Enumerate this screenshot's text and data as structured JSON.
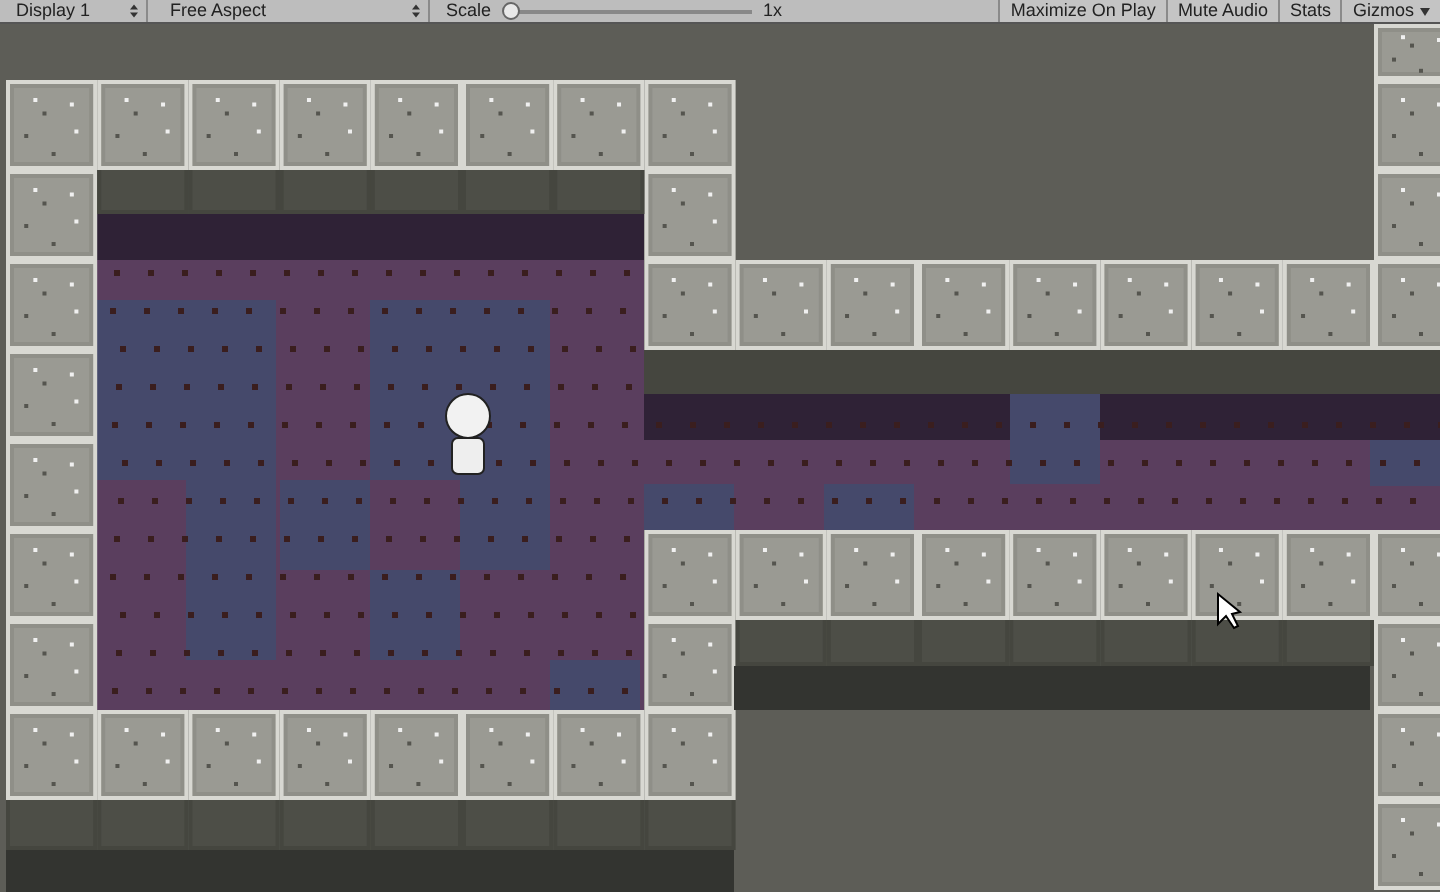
{
  "toolbar": {
    "display": {
      "value": "Display 1"
    },
    "aspect": {
      "value": "Free Aspect"
    },
    "scale": {
      "label": "Scale",
      "level": 0.02,
      "reading": "1x"
    },
    "buttons": [
      {
        "label": "Maximize On Play",
        "kind": "toggle",
        "on": false
      },
      {
        "label": "Mute Audio",
        "kind": "toggle",
        "on": false
      },
      {
        "label": "Stats",
        "kind": "toggle",
        "on": false
      },
      {
        "label": "Gizmos",
        "kind": "dropdown",
        "on": false
      }
    ]
  }
}
